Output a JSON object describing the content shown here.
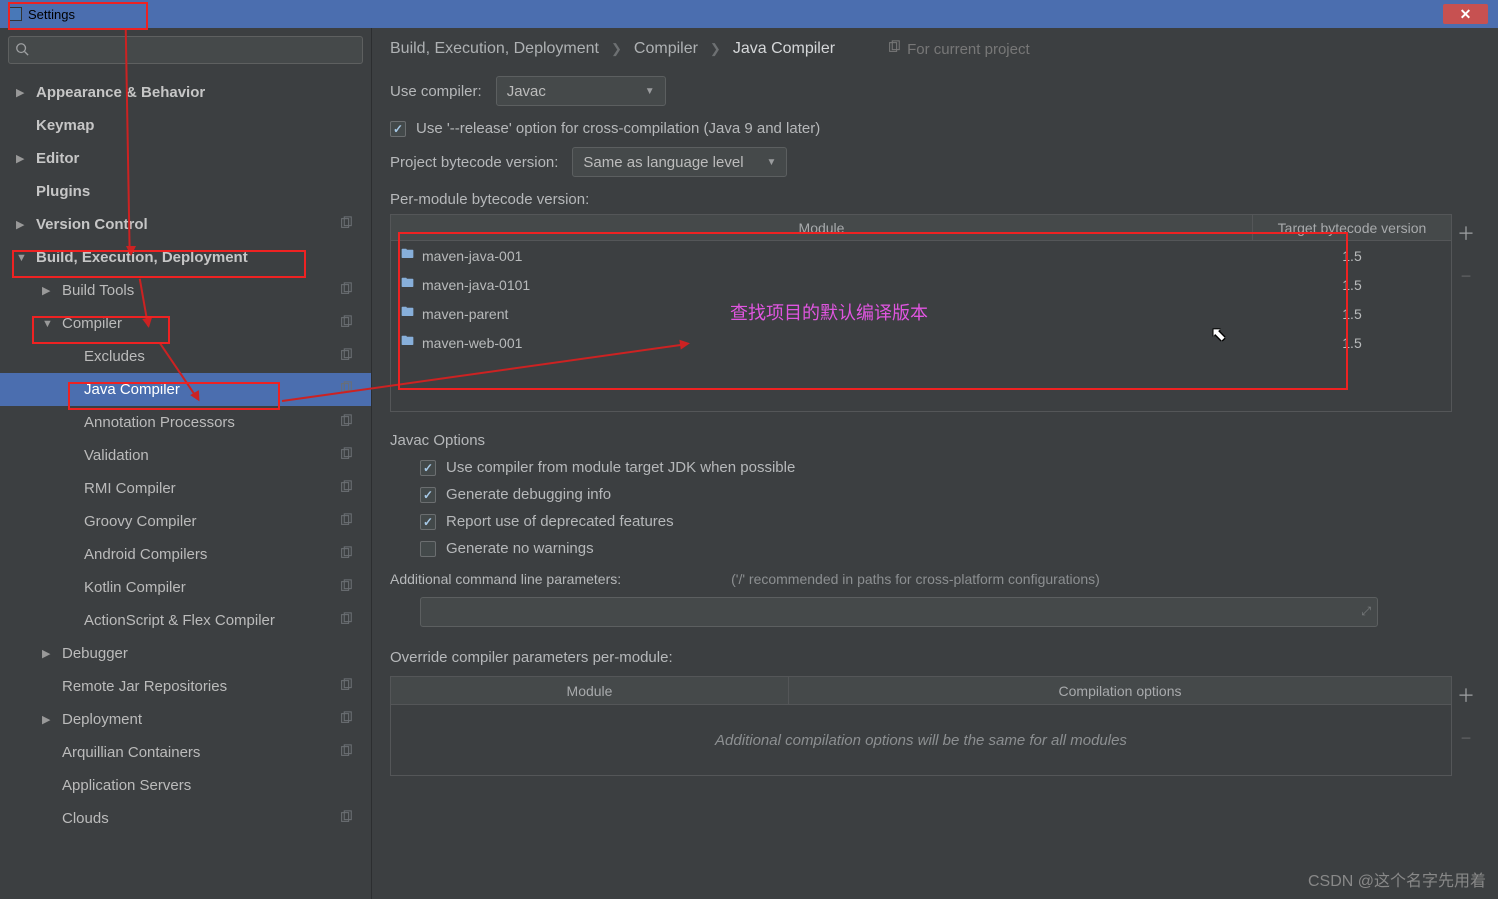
{
  "window": {
    "title": "Settings",
    "close_glyph": "✕"
  },
  "search": {
    "placeholder": ""
  },
  "sidebar": {
    "items": [
      {
        "label": "Appearance & Behavior",
        "arrow": "▶",
        "indent": 0,
        "bold": true,
        "copy": false
      },
      {
        "label": "Keymap",
        "arrow": "",
        "indent": 0,
        "bold": true,
        "copy": false
      },
      {
        "label": "Editor",
        "arrow": "▶",
        "indent": 0,
        "bold": true,
        "copy": false
      },
      {
        "label": "Plugins",
        "arrow": "",
        "indent": 0,
        "bold": true,
        "copy": false
      },
      {
        "label": "Version Control",
        "arrow": "▶",
        "indent": 0,
        "bold": true,
        "copy": true
      },
      {
        "label": "Build, Execution, Deployment",
        "arrow": "▼",
        "indent": 0,
        "bold": true,
        "copy": false
      },
      {
        "label": "Build Tools",
        "arrow": "▶",
        "indent": 1,
        "bold": false,
        "copy": true
      },
      {
        "label": "Compiler",
        "arrow": "▼",
        "indent": 1,
        "bold": false,
        "copy": true
      },
      {
        "label": "Excludes",
        "arrow": "",
        "indent": 2,
        "bold": false,
        "copy": true
      },
      {
        "label": "Java Compiler",
        "arrow": "",
        "indent": 2,
        "bold": false,
        "copy": true,
        "selected": true
      },
      {
        "label": "Annotation Processors",
        "arrow": "",
        "indent": 2,
        "bold": false,
        "copy": true
      },
      {
        "label": "Validation",
        "arrow": "",
        "indent": 2,
        "bold": false,
        "copy": true
      },
      {
        "label": "RMI Compiler",
        "arrow": "",
        "indent": 2,
        "bold": false,
        "copy": true
      },
      {
        "label": "Groovy Compiler",
        "arrow": "",
        "indent": 2,
        "bold": false,
        "copy": true
      },
      {
        "label": "Android Compilers",
        "arrow": "",
        "indent": 2,
        "bold": false,
        "copy": true
      },
      {
        "label": "Kotlin Compiler",
        "arrow": "",
        "indent": 2,
        "bold": false,
        "copy": true
      },
      {
        "label": "ActionScript & Flex Compiler",
        "arrow": "",
        "indent": 2,
        "bold": false,
        "copy": true
      },
      {
        "label": "Debugger",
        "arrow": "▶",
        "indent": 1,
        "bold": false,
        "copy": false
      },
      {
        "label": "Remote Jar Repositories",
        "arrow": "",
        "indent": 1,
        "bold": false,
        "copy": true
      },
      {
        "label": "Deployment",
        "arrow": "▶",
        "indent": 1,
        "bold": false,
        "copy": true
      },
      {
        "label": "Arquillian Containers",
        "arrow": "",
        "indent": 1,
        "bold": false,
        "copy": true
      },
      {
        "label": "Application Servers",
        "arrow": "",
        "indent": 1,
        "bold": false,
        "copy": false
      },
      {
        "label": "Clouds",
        "arrow": "",
        "indent": 1,
        "bold": false,
        "copy": true
      }
    ]
  },
  "breadcrumb": {
    "items": [
      "Build, Execution, Deployment",
      "Compiler",
      "Java Compiler"
    ],
    "note": "For current project"
  },
  "compiler": {
    "use_compiler_label": "Use compiler:",
    "use_compiler_value": "Javac",
    "release_option": "Use '--release' option for cross-compilation (Java 9 and later)",
    "project_bytecode_label": "Project bytecode version:",
    "project_bytecode_value": "Same as language level",
    "per_module_label": "Per-module bytecode version:",
    "table_headers": {
      "module": "Module",
      "target": "Target bytecode version"
    },
    "modules": [
      {
        "name": "maven-java-001",
        "target": "1.5"
      },
      {
        "name": "maven-java-0101",
        "target": "1.5"
      },
      {
        "name": "maven-parent",
        "target": "1.5"
      },
      {
        "name": "maven-web-001",
        "target": "1.5"
      }
    ],
    "add_glyph": "＋",
    "remove_glyph": "−"
  },
  "javac": {
    "title": "Javac Options",
    "opt1": "Use compiler from module target JDK when possible",
    "opt2": "Generate debugging info",
    "opt3": "Report use of deprecated features",
    "opt4": "Generate no warnings",
    "cmdline_label": "Additional command line parameters:",
    "cmdline_hint": "('/' recommended in paths for cross-platform configurations)",
    "override_label": "Override compiler parameters per-module:",
    "override_headers": {
      "module": "Module",
      "options": "Compilation options"
    },
    "override_empty": "Additional compilation options will be the same for all modules"
  },
  "annotation": {
    "pink_text": "查找项目的默认编译版本"
  },
  "watermark": "CSDN @这个名字先用着"
}
